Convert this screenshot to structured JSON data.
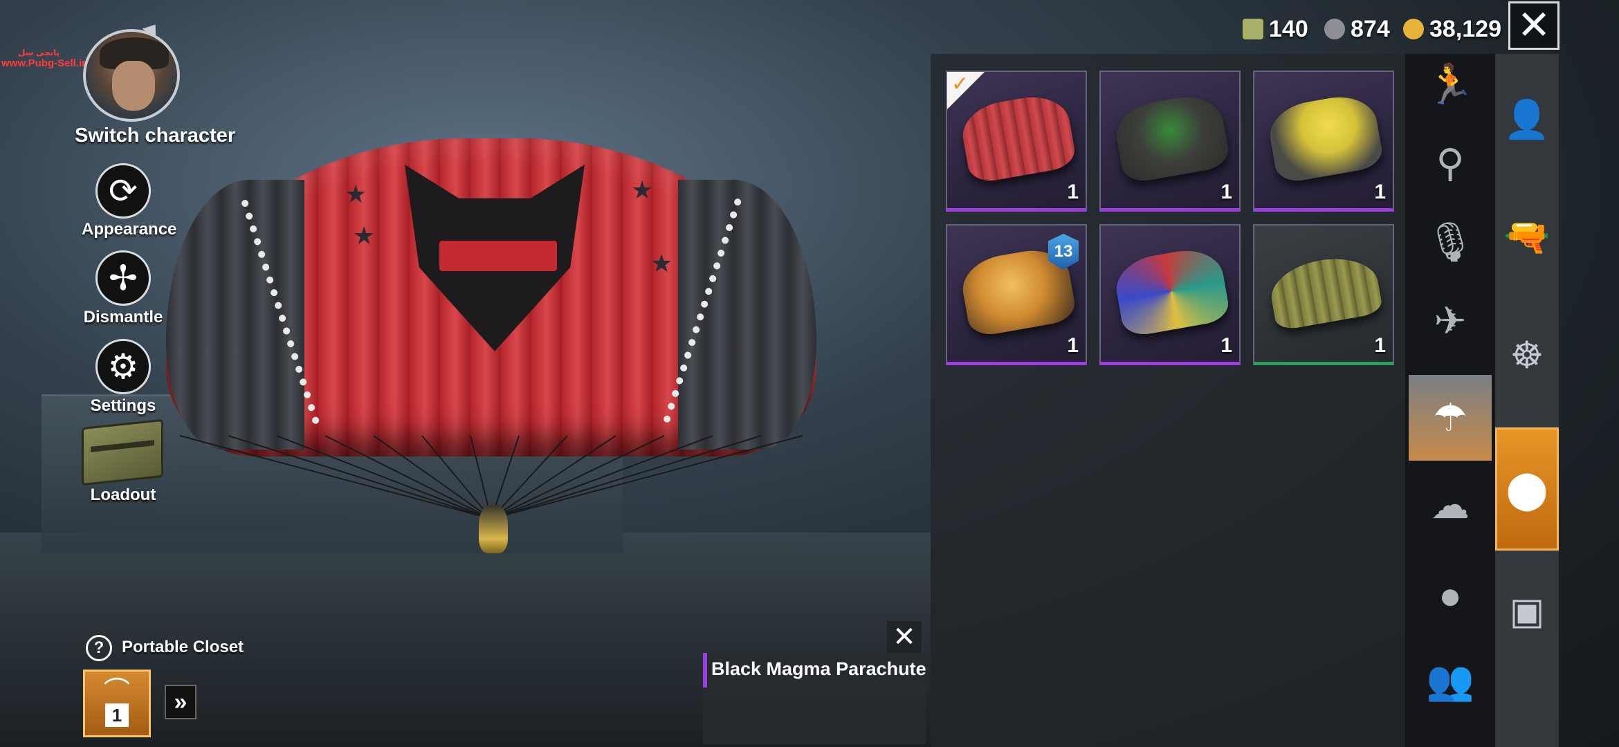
{
  "watermark": {
    "line1": "پابجی سل",
    "line2": "www.Pubg-Sell.ir"
  },
  "currency": [
    {
      "icon": "g-coin-icon",
      "value": "140",
      "color": "#a9b06a"
    },
    {
      "icon": "bp-icon",
      "value": "874",
      "color": "#8e8f94"
    },
    {
      "icon": "gold-coin-icon",
      "value": "38,129",
      "color": "#e6b43a"
    }
  ],
  "left_menu": {
    "switch_character": "Switch character",
    "appearance": "Appearance",
    "dismantle": "Dismantle",
    "settings": "Settings",
    "loadout": "Loadout"
  },
  "inventory": {
    "items": [
      {
        "name": "red-parachute",
        "qty": "1",
        "rarity": "purple",
        "selected": true,
        "color": "#b8353a"
      },
      {
        "name": "green-graffiti-pack",
        "qty": "1",
        "rarity": "purple",
        "color": "#3c3f3a"
      },
      {
        "name": "yellow-moon-pack",
        "qty": "1",
        "rarity": "purple",
        "color": "#d6c23a"
      },
      {
        "name": "skull-poster-pack",
        "qty": "1",
        "rarity": "purple",
        "badge": "13",
        "color": "#d08a30"
      },
      {
        "name": "colorful-pattern-pack",
        "qty": "1",
        "rarity": "purple",
        "color": "#c83a3a"
      },
      {
        "name": "olive-parachute",
        "qty": "1",
        "rarity": "green",
        "color": "#7d7c3e"
      }
    ]
  },
  "categories": [
    "emote-icon",
    "location-pin-icon",
    "microphone-icon",
    "airplane-icon",
    "parachute-icon",
    "smoke-icon",
    "grenade-icon",
    "companion-icon"
  ],
  "side_tabs": [
    "character-icon",
    "pistol-icon",
    "steering-wheel-icon",
    "skydive-icon",
    "crate-icon"
  ],
  "portable_closet": {
    "label": "Portable Closet",
    "count": "1",
    "help": "?"
  },
  "selected_item": {
    "name": "Black Magma Parachute"
  },
  "close": "✕"
}
